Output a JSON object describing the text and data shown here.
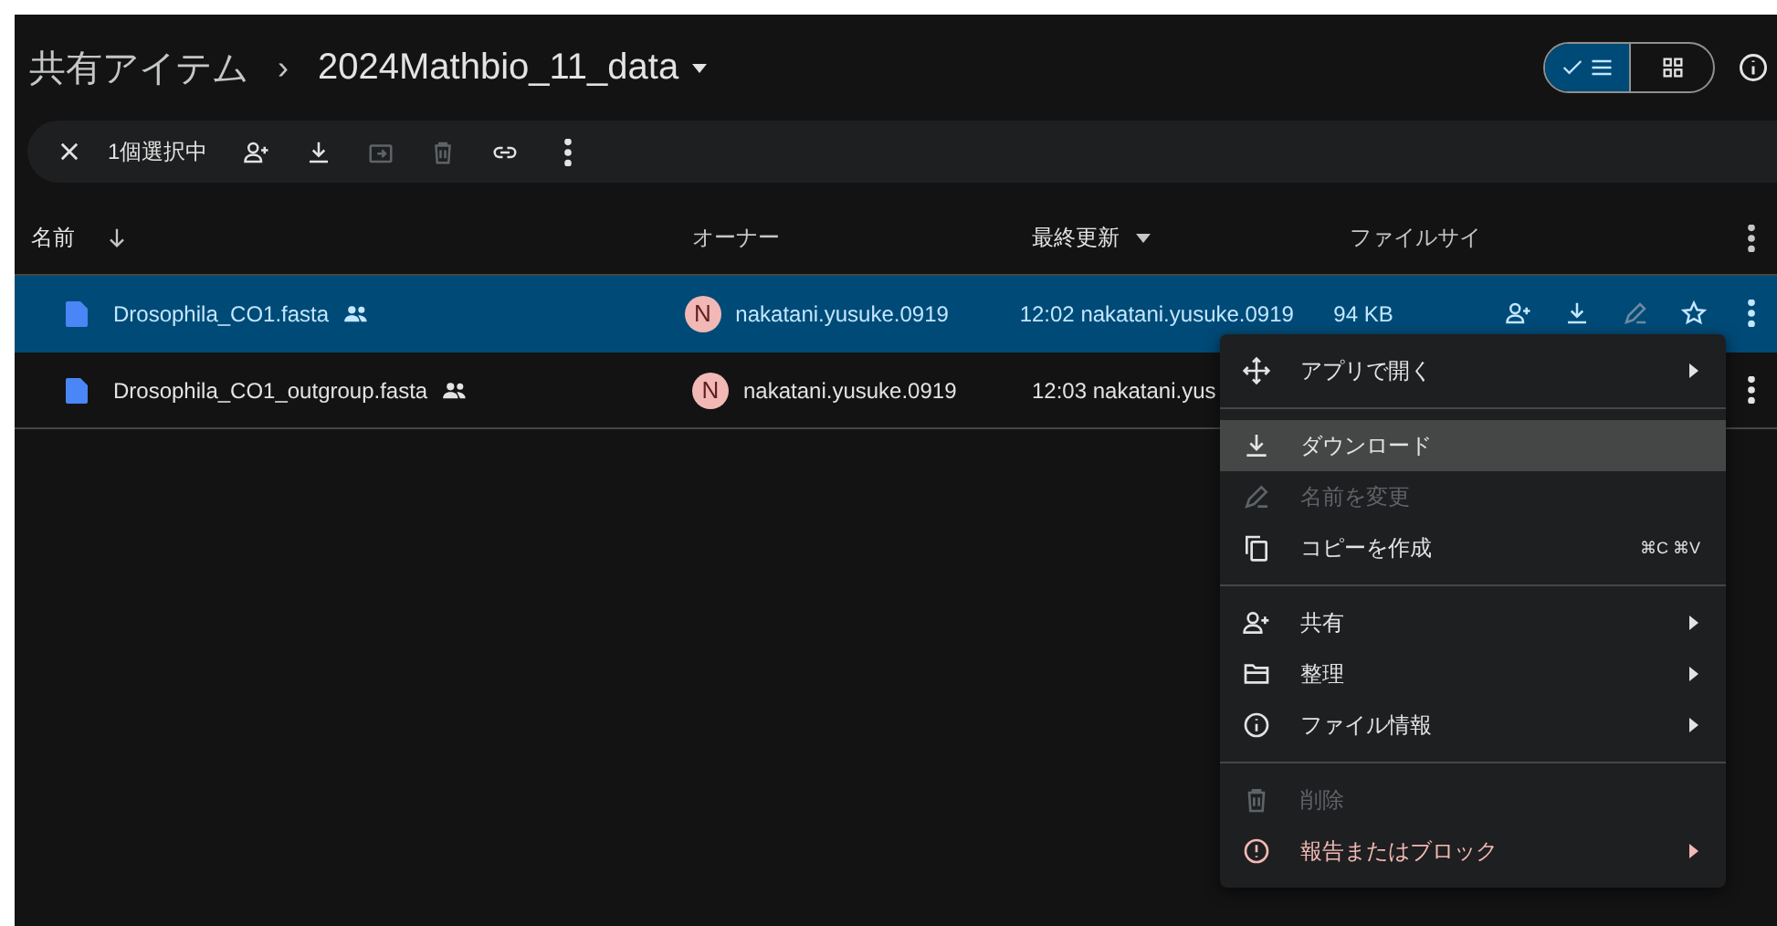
{
  "breadcrumb": {
    "parent": "共有アイテム",
    "separator": "›",
    "current": "2024Mathbio_11_data"
  },
  "view_toggle": [
    {
      "selected": true
    },
    {
      "selected": false
    }
  ],
  "selection_toolbar": {
    "count": "1個選択中",
    "actions": [
      {
        "disabled": false
      },
      {
        "disabled": false
      },
      {
        "disabled": true
      },
      {
        "disabled": true
      },
      {
        "disabled": false
      },
      {
        "disabled": false
      }
    ]
  },
  "table": {
    "columns": [
      {
        "label": "名前",
        "sorted": true
      },
      {
        "label": "オーナー",
        "sorted": false
      },
      {
        "label": "最終更新",
        "sorted": true
      },
      {
        "label": "ファイルサイ",
        "sorted": false
      }
    ],
    "rows": [
      {
        "name": "Drosophila_CO1.fasta",
        "shared": true,
        "owner_initial": "N",
        "owner": "nakatani.yusuke.0919",
        "modified": "12:02 nakatani.yusuke.0919",
        "size": "94 KB",
        "selected": true
      },
      {
        "name": "Drosophila_CO1_outgroup.fasta",
        "shared": true,
        "owner_initial": "N",
        "owner": "nakatani.yusuke.0919",
        "modified": "12:03 nakatani.yus",
        "size": "",
        "selected": false
      }
    ],
    "row_actions": [
      {
        "disabled": false
      },
      {
        "disabled": false
      },
      {
        "disabled": true
      },
      {
        "disabled": false
      }
    ]
  },
  "context_menu": {
    "groups": [
      {
        "items": [
          {
            "label": "アプリで開く",
            "kind": "normal",
            "submenu": true,
            "highlighted": false
          }
        ]
      },
      {
        "items": [
          {
            "label": "ダウンロード",
            "kind": "normal",
            "submenu": false,
            "highlighted": true
          },
          {
            "label": "名前を変更",
            "kind": "disabled",
            "submenu": false,
            "highlighted": false
          },
          {
            "label": "コピーを作成",
            "kind": "normal",
            "submenu": false,
            "highlighted": false,
            "shortcut": "⌘C ⌘V"
          }
        ]
      },
      {
        "items": [
          {
            "label": "共有",
            "kind": "normal",
            "submenu": true,
            "highlighted": false
          },
          {
            "label": "整理",
            "kind": "normal",
            "submenu": true,
            "highlighted": false
          },
          {
            "label": "ファイル情報",
            "kind": "normal",
            "submenu": true,
            "highlighted": false
          }
        ]
      },
      {
        "items": [
          {
            "label": "削除",
            "kind": "disabled",
            "submenu": false,
            "highlighted": false
          },
          {
            "label": "報告またはブロック",
            "kind": "danger",
            "submenu": true,
            "highlighted": false
          }
        ]
      }
    ]
  }
}
